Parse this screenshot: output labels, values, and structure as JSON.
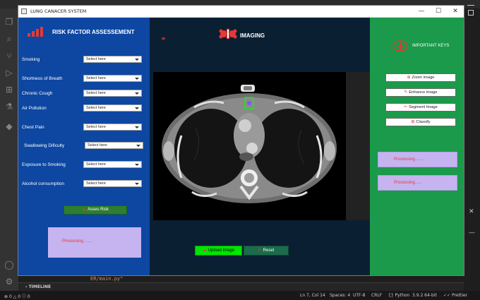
{
  "app": {
    "title": "LUNG CANACER SYSTEM",
    "window_controls": {
      "minimize": "—",
      "maximize": "☐",
      "close": "✕"
    }
  },
  "risk_panel": {
    "title": "RISK FACTOR ASSESSEMENT",
    "factors": [
      {
        "label": "Smoking",
        "select": "Select here"
      },
      {
        "label": "Shortness of Breath",
        "select": "Select here"
      },
      {
        "label": "Chronic Cough",
        "select": "Select here"
      },
      {
        "label": "Air Pollution",
        "select": "Select here"
      },
      {
        "label": "Chest Pain",
        "select": "Select here"
      },
      {
        "label": "Swallowing Dificulty",
        "select": "Select here"
      },
      {
        "label": "Exposure to Smoking",
        "select": "Select here"
      },
      {
        "label": "Alcohol consumption",
        "select": "Select here"
      }
    ],
    "assess_button": "Asses Risk",
    "status": "Processing........"
  },
  "imaging_panel": {
    "title": "IMAGING",
    "upload_button": "Upload Image",
    "reset_button": "Reset"
  },
  "keys_panel": {
    "title": "IMPORTANT KEYS",
    "buttons": [
      "Zoom image",
      "Enhance image",
      "Segment Image",
      "Classify"
    ],
    "status_1": "Processing.......",
    "status_2": "Processing......"
  },
  "vscode": {
    "editor_line": "ER/main.py\"",
    "timeline_label": "TIMELINE",
    "status": {
      "errors": "0",
      "warnings": "0",
      "info": "0",
      "position": "Ln 7, Col 14",
      "spaces": "Spaces: 4",
      "encoding": "UTF-8",
      "eol": "CRLF",
      "language": "Python",
      "interpreter": "3.9.2 64-bit",
      "formatter": "Prettier"
    }
  },
  "colors": {
    "left_panel": "#0d47a1",
    "mid_panel": "#0b1f33",
    "right_panel": "#1a9a4a",
    "status_box": "#c5b4f0",
    "accent_red": "#e53935",
    "upload_green": "#00e600"
  }
}
